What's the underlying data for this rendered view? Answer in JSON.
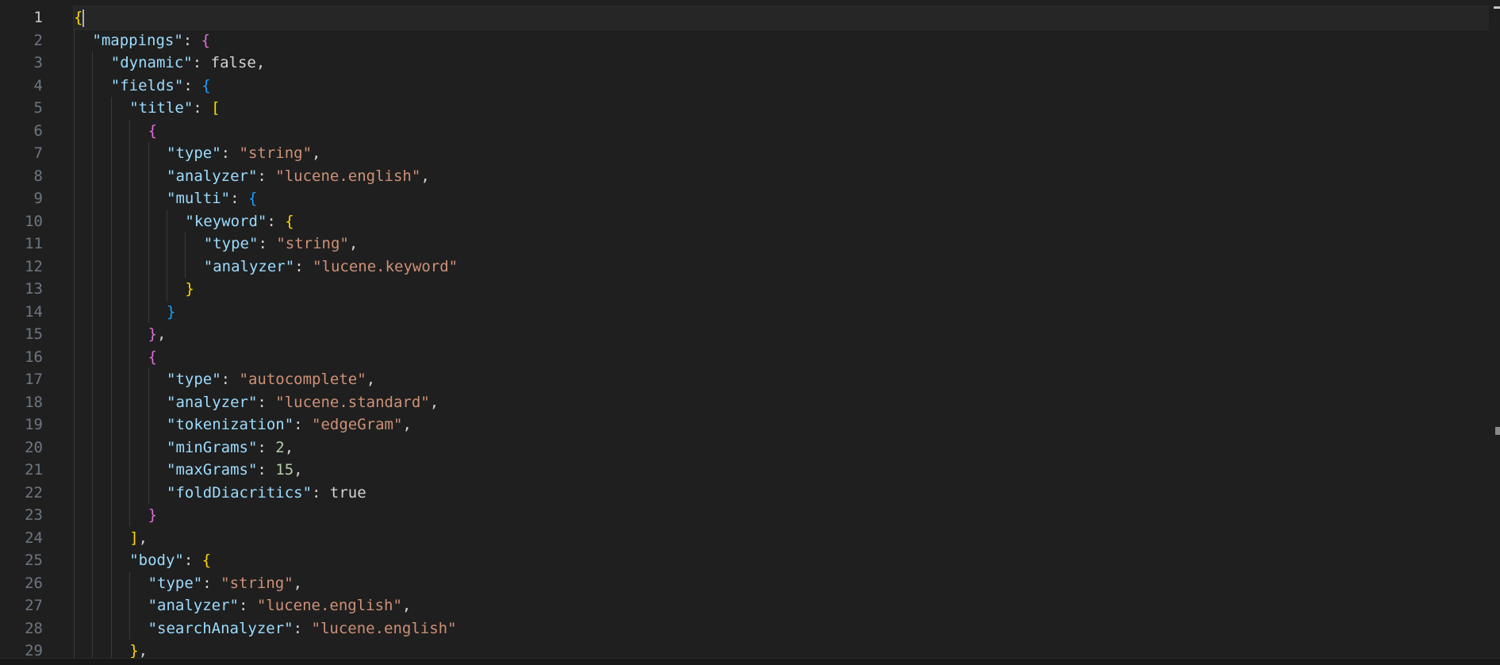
{
  "editor": {
    "active_line": 1,
    "lines": [
      {
        "n": "1",
        "indent": 0,
        "tokens": [
          {
            "t": "{",
            "c": "#ffd700"
          }
        ]
      },
      {
        "n": "2",
        "indent": 1,
        "tokens": [
          {
            "t": "\"mappings\"",
            "c": "#9cdcfe"
          },
          {
            "t": ": ",
            "c": "#d4d4d4"
          },
          {
            "t": "{",
            "c": "#da70d6"
          }
        ]
      },
      {
        "n": "3",
        "indent": 2,
        "tokens": [
          {
            "t": "\"dynamic\"",
            "c": "#9cdcfe"
          },
          {
            "t": ": ",
            "c": "#d4d4d4"
          },
          {
            "t": "false",
            "c": "#d4d4d4"
          },
          {
            "t": ",",
            "c": "#d4d4d4"
          }
        ]
      },
      {
        "n": "4",
        "indent": 2,
        "tokens": [
          {
            "t": "\"fields\"",
            "c": "#9cdcfe"
          },
          {
            "t": ": ",
            "c": "#d4d4d4"
          },
          {
            "t": "{",
            "c": "#179fff"
          }
        ]
      },
      {
        "n": "5",
        "indent": 3,
        "tokens": [
          {
            "t": "\"title\"",
            "c": "#9cdcfe"
          },
          {
            "t": ": ",
            "c": "#d4d4d4"
          },
          {
            "t": "[",
            "c": "#ffd700"
          }
        ]
      },
      {
        "n": "6",
        "indent": 4,
        "tokens": [
          {
            "t": "{",
            "c": "#da70d6"
          }
        ]
      },
      {
        "n": "7",
        "indent": 5,
        "tokens": [
          {
            "t": "\"type\"",
            "c": "#9cdcfe"
          },
          {
            "t": ": ",
            "c": "#d4d4d4"
          },
          {
            "t": "\"string\"",
            "c": "#ce9178"
          },
          {
            "t": ",",
            "c": "#d4d4d4"
          }
        ]
      },
      {
        "n": "8",
        "indent": 5,
        "tokens": [
          {
            "t": "\"analyzer\"",
            "c": "#9cdcfe"
          },
          {
            "t": ": ",
            "c": "#d4d4d4"
          },
          {
            "t": "\"lucene.english\"",
            "c": "#ce9178"
          },
          {
            "t": ",",
            "c": "#d4d4d4"
          }
        ]
      },
      {
        "n": "9",
        "indent": 5,
        "tokens": [
          {
            "t": "\"multi\"",
            "c": "#9cdcfe"
          },
          {
            "t": ": ",
            "c": "#d4d4d4"
          },
          {
            "t": "{",
            "c": "#179fff"
          }
        ]
      },
      {
        "n": "10",
        "indent": 6,
        "tokens": [
          {
            "t": "\"keyword\"",
            "c": "#9cdcfe"
          },
          {
            "t": ": ",
            "c": "#d4d4d4"
          },
          {
            "t": "{",
            "c": "#ffd700"
          }
        ]
      },
      {
        "n": "11",
        "indent": 7,
        "tokens": [
          {
            "t": "\"type\"",
            "c": "#9cdcfe"
          },
          {
            "t": ": ",
            "c": "#d4d4d4"
          },
          {
            "t": "\"string\"",
            "c": "#ce9178"
          },
          {
            "t": ",",
            "c": "#d4d4d4"
          }
        ]
      },
      {
        "n": "12",
        "indent": 7,
        "tokens": [
          {
            "t": "\"analyzer\"",
            "c": "#9cdcfe"
          },
          {
            "t": ": ",
            "c": "#d4d4d4"
          },
          {
            "t": "\"lucene.keyword\"",
            "c": "#ce9178"
          }
        ]
      },
      {
        "n": "13",
        "indent": 6,
        "tokens": [
          {
            "t": "}",
            "c": "#ffd700"
          }
        ]
      },
      {
        "n": "14",
        "indent": 5,
        "tokens": [
          {
            "t": "}",
            "c": "#179fff"
          }
        ]
      },
      {
        "n": "15",
        "indent": 4,
        "tokens": [
          {
            "t": "}",
            "c": "#da70d6"
          },
          {
            "t": ",",
            "c": "#d4d4d4"
          }
        ]
      },
      {
        "n": "16",
        "indent": 4,
        "tokens": [
          {
            "t": "{",
            "c": "#da70d6"
          }
        ]
      },
      {
        "n": "17",
        "indent": 5,
        "tokens": [
          {
            "t": "\"type\"",
            "c": "#9cdcfe"
          },
          {
            "t": ": ",
            "c": "#d4d4d4"
          },
          {
            "t": "\"autocomplete\"",
            "c": "#ce9178"
          },
          {
            "t": ",",
            "c": "#d4d4d4"
          }
        ]
      },
      {
        "n": "18",
        "indent": 5,
        "tokens": [
          {
            "t": "\"analyzer\"",
            "c": "#9cdcfe"
          },
          {
            "t": ": ",
            "c": "#d4d4d4"
          },
          {
            "t": "\"lucene.standard\"",
            "c": "#ce9178"
          },
          {
            "t": ",",
            "c": "#d4d4d4"
          }
        ]
      },
      {
        "n": "19",
        "indent": 5,
        "tokens": [
          {
            "t": "\"tokenization\"",
            "c": "#9cdcfe"
          },
          {
            "t": ": ",
            "c": "#d4d4d4"
          },
          {
            "t": "\"edgeGram\"",
            "c": "#ce9178"
          },
          {
            "t": ",",
            "c": "#d4d4d4"
          }
        ]
      },
      {
        "n": "20",
        "indent": 5,
        "tokens": [
          {
            "t": "\"minGrams\"",
            "c": "#9cdcfe"
          },
          {
            "t": ": ",
            "c": "#d4d4d4"
          },
          {
            "t": "2",
            "c": "#b5cea8"
          },
          {
            "t": ",",
            "c": "#d4d4d4"
          }
        ]
      },
      {
        "n": "21",
        "indent": 5,
        "tokens": [
          {
            "t": "\"maxGrams\"",
            "c": "#9cdcfe"
          },
          {
            "t": ": ",
            "c": "#d4d4d4"
          },
          {
            "t": "15",
            "c": "#b5cea8"
          },
          {
            "t": ",",
            "c": "#d4d4d4"
          }
        ]
      },
      {
        "n": "22",
        "indent": 5,
        "tokens": [
          {
            "t": "\"foldDiacritics\"",
            "c": "#9cdcfe"
          },
          {
            "t": ": ",
            "c": "#d4d4d4"
          },
          {
            "t": "true",
            "c": "#d4d4d4"
          }
        ]
      },
      {
        "n": "23",
        "indent": 4,
        "tokens": [
          {
            "t": "}",
            "c": "#da70d6"
          }
        ]
      },
      {
        "n": "24",
        "indent": 3,
        "tokens": [
          {
            "t": "]",
            "c": "#ffd700"
          },
          {
            "t": ",",
            "c": "#d4d4d4"
          }
        ]
      },
      {
        "n": "25",
        "indent": 3,
        "tokens": [
          {
            "t": "\"body\"",
            "c": "#9cdcfe"
          },
          {
            "t": ": ",
            "c": "#d4d4d4"
          },
          {
            "t": "{",
            "c": "#ffd700"
          }
        ]
      },
      {
        "n": "26",
        "indent": 4,
        "tokens": [
          {
            "t": "\"type\"",
            "c": "#9cdcfe"
          },
          {
            "t": ": ",
            "c": "#d4d4d4"
          },
          {
            "t": "\"string\"",
            "c": "#ce9178"
          },
          {
            "t": ",",
            "c": "#d4d4d4"
          }
        ]
      },
      {
        "n": "27",
        "indent": 4,
        "tokens": [
          {
            "t": "\"analyzer\"",
            "c": "#9cdcfe"
          },
          {
            "t": ": ",
            "c": "#d4d4d4"
          },
          {
            "t": "\"lucene.english\"",
            "c": "#ce9178"
          },
          {
            "t": ",",
            "c": "#d4d4d4"
          }
        ]
      },
      {
        "n": "28",
        "indent": 4,
        "tokens": [
          {
            "t": "\"searchAnalyzer\"",
            "c": "#9cdcfe"
          },
          {
            "t": ": ",
            "c": "#d4d4d4"
          },
          {
            "t": "\"lucene.english\"",
            "c": "#ce9178"
          }
        ]
      },
      {
        "n": "29",
        "indent": 3,
        "tokens": [
          {
            "t": "}",
            "c": "#ffd700"
          },
          {
            "t": ",",
            "c": "#d4d4d4"
          }
        ]
      }
    ]
  },
  "colors": {
    "background": "#1f1f1f",
    "line_number": "#6e7681",
    "line_number_active": "#cccccc",
    "property_key": "#9cdcfe",
    "string_value": "#ce9178",
    "number_value": "#b5cea8",
    "bracket_gold": "#ffd700",
    "bracket_orchid": "#da70d6",
    "bracket_blue": "#179fff",
    "indent_guide": "#3a3a3a"
  }
}
